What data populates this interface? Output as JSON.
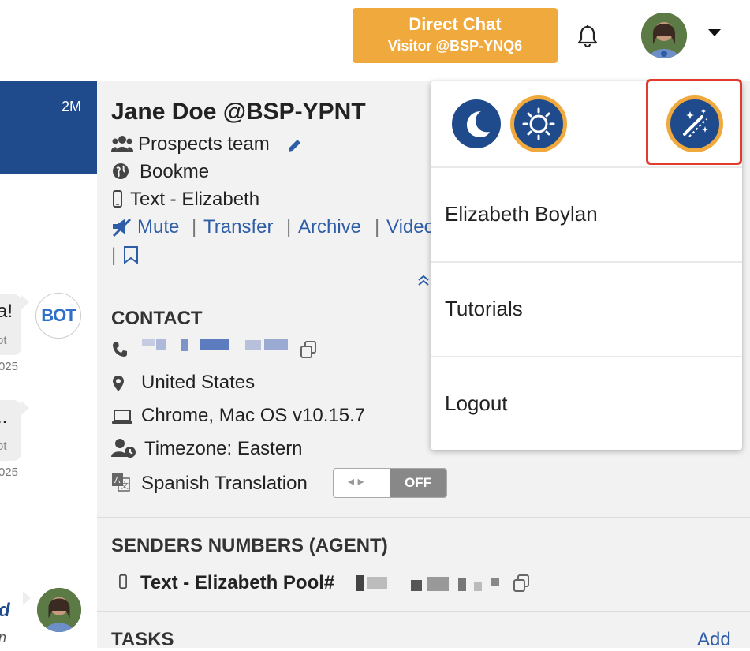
{
  "header": {
    "direct_chat_title": "Direct Chat",
    "direct_chat_visitor": "Visitor @BSP-YNQ6",
    "accent_color": "#f0a93c"
  },
  "left_panel": {
    "active_conv_time": "2M",
    "bot_avatar_text": "BOT",
    "bubbles": [
      {
        "big": "a!",
        "small": "ot",
        "stamp": "025"
      },
      {
        "big": "..",
        "small": "ot",
        "stamp": "025"
      }
    ],
    "agent_msg_line1": "d",
    "agent_msg_line2": "n"
  },
  "contact_header": {
    "name": "Jane Doe @BSP-YPNT",
    "team": "Prospects team",
    "site": "Bookme",
    "channel": "Text - Elizabeth",
    "actions": {
      "mute": "Mute",
      "transfer": "Transfer",
      "archive": "Archive",
      "video": "Video"
    },
    "separator": "|"
  },
  "contact": {
    "section_title": "CONTACT",
    "country": "United States",
    "browser": "Chrome, Mac OS v10.15.7",
    "timezone": "Timezone: Eastern",
    "translation_label": "Spanish Translation",
    "translation_state": "OFF"
  },
  "senders": {
    "section_title": "SENDERS NUMBERS (AGENT)",
    "pool_label": "Text - Elizabeth Pool#"
  },
  "tasks": {
    "section_title": "TASKS",
    "add_label": "Add"
  },
  "user_menu": {
    "username": "Elizabeth Boylan",
    "tutorials": "Tutorials",
    "logout": "Logout",
    "themes": [
      "moon-icon",
      "sun-icon",
      "magic-wand-icon"
    ]
  }
}
